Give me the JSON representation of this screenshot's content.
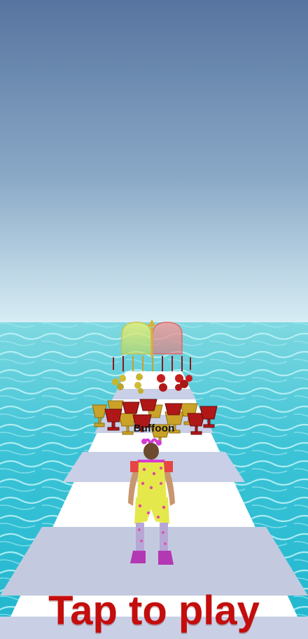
{
  "player": {
    "name_label": "Buffoon"
  },
  "prompt": {
    "text": "Tap to play"
  },
  "colors": {
    "sky_top": "#5b7aa6",
    "sky_bottom": "#cfe6f2",
    "sea": "#3fc7d8",
    "runway_light": "#ffffff",
    "runway_dark": "#c9d0e6",
    "prompt_text": "#c40d0d",
    "gate_left": "#d9e85a",
    "gate_right": "#f08080",
    "trophy_gold": "#c9a227",
    "trophy_red": "#b01818"
  }
}
